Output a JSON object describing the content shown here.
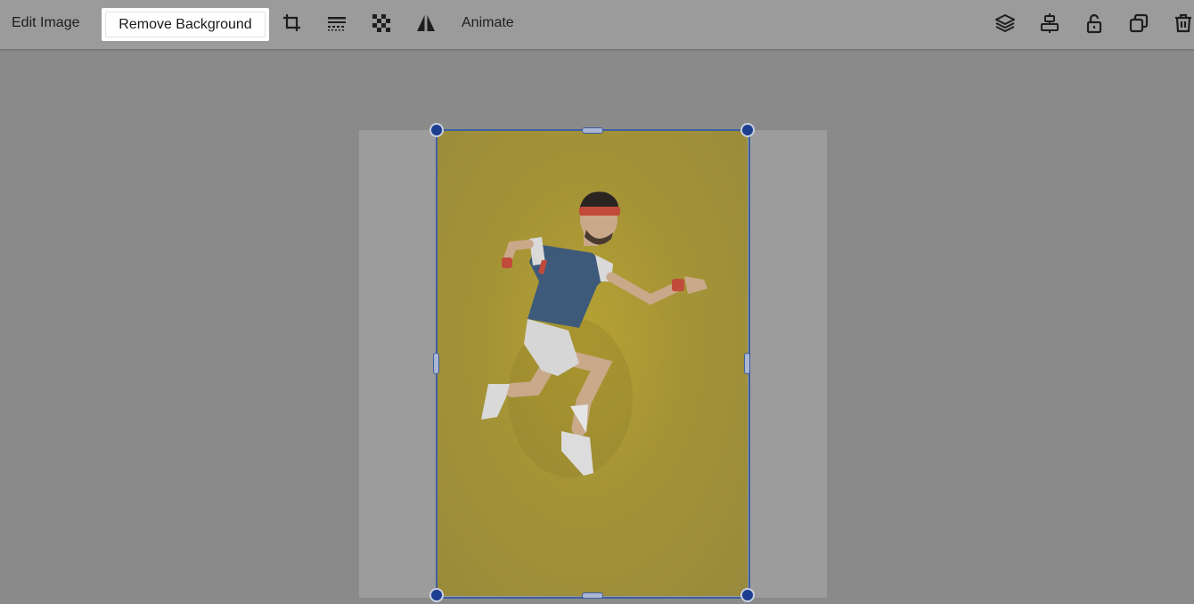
{
  "toolbar": {
    "edit_image_label": "Edit Image",
    "remove_background_label": "Remove Background",
    "animate_label": "Animate",
    "left_icons": [
      "crop-icon",
      "adjust-icon",
      "transparency-icon",
      "flip-icon"
    ],
    "right_icons": [
      "layers-icon",
      "align-icon",
      "unlock-icon",
      "duplicate-icon",
      "trash-icon"
    ]
  },
  "canvas": {
    "photo_subject": "image",
    "colors": {
      "photo_background": "#a49336",
      "selection": "#3f5fa0",
      "handle": "#1d3d8f"
    }
  }
}
